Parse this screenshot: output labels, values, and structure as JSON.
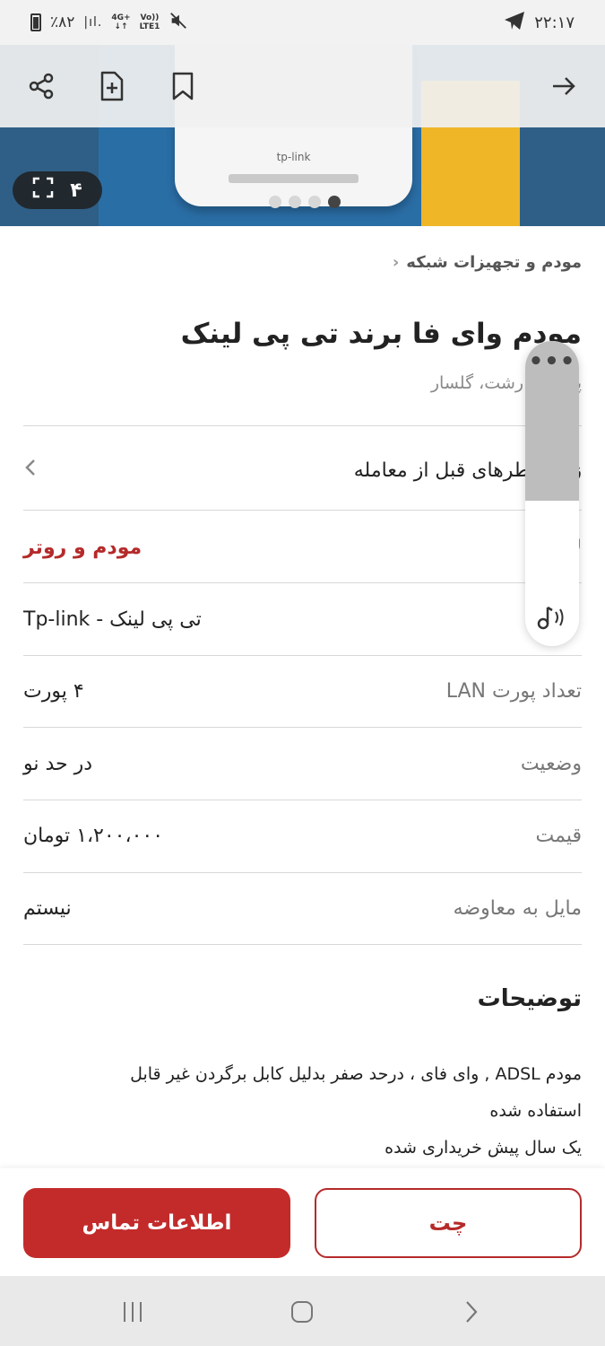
{
  "status_bar": {
    "battery": "٪۸۲",
    "net_top": "4G+",
    "net_bottom": "LTE1",
    "volte": "Vo))",
    "time": "۲۲:۱۷"
  },
  "gallery": {
    "count": "۴",
    "dots_total": 4,
    "active_dot": 4,
    "brand_text": "tp-link"
  },
  "icons": {
    "share": "share-icon",
    "note": "add-note-icon",
    "bookmark": "bookmark-icon",
    "back": "arrow-right-icon",
    "fullscreen": "fullscreen-icon"
  },
  "breadcrumb": "مودم و تجهیزات شبکه",
  "title": "مودم  وای فا برند تی پی لینک",
  "subtitle": "پیش در رشت، گلسار",
  "warning_text": "زنگ خطرهای قبل از معامله",
  "attributes": [
    {
      "label": "لا",
      "value": "مودم و روتر"
    },
    {
      "label": "",
      "value": "تی پی لینک - Tp-link"
    },
    {
      "label": "تعداد پورت LAN",
      "value": "۴ پورت"
    },
    {
      "label": "وضعیت",
      "value": "در حد نو"
    },
    {
      "label": "قیمت",
      "value": "۱،۲۰۰،۰۰۰ تومان"
    },
    {
      "label": "مایل به معاوضه",
      "value": "نیستم"
    }
  ],
  "description": {
    "title": "توضیحات",
    "lines": [
      "مودم ADSL , وای فای ، درحد صفر بدلیل کابل برگردن غیر قابل",
      "استفاده شده",
      "یک سال پیش خریداری شده"
    ]
  },
  "float_panel": {
    "menu": "•••",
    "level": 0.55
  },
  "actions": {
    "chat": "چت",
    "contact": "اطلاعات تماس"
  },
  "colors": {
    "accent": "#c32b2b",
    "accent_dark": "#b52a2a"
  }
}
